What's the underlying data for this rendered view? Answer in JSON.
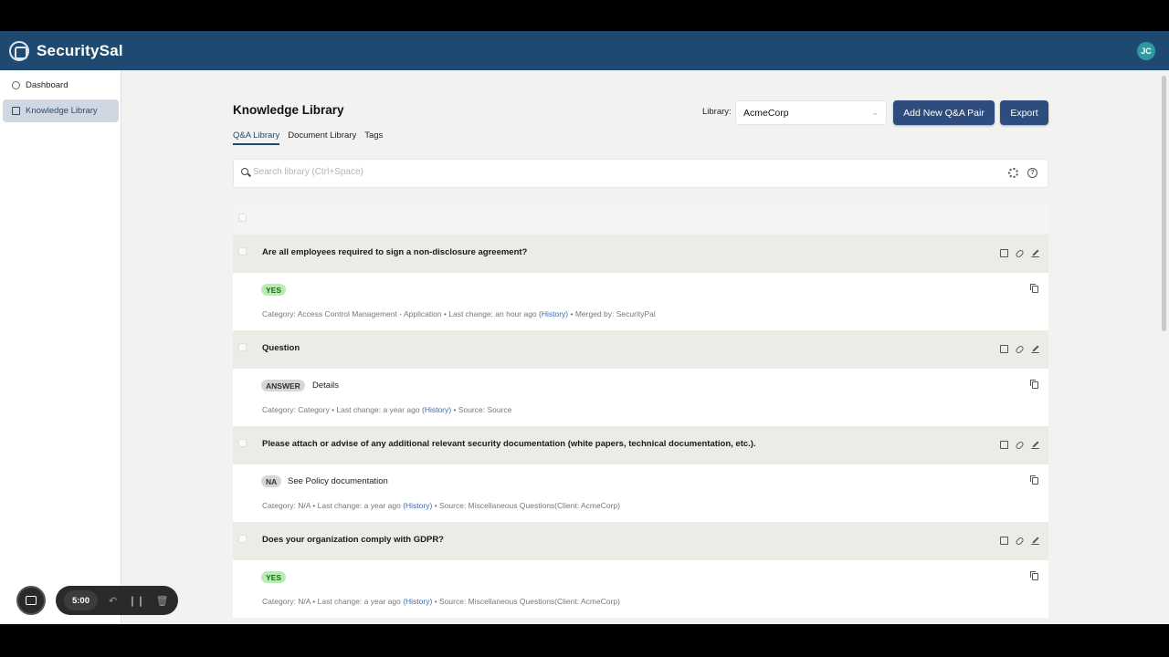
{
  "app": {
    "name": "SecuritySal",
    "avatar_initials": "JC",
    "accent": "#1e4a72"
  },
  "sidebar": {
    "items": [
      {
        "label": "Dashboard",
        "icon": "dashboard-icon",
        "active": false
      },
      {
        "label": "Knowledge Library",
        "icon": "book-icon",
        "active": true
      }
    ]
  },
  "page": {
    "title": "Knowledge Library",
    "tabs": [
      "Q&A Library",
      "Document Library",
      "Tags"
    ],
    "library_label": "Library:",
    "library_value": "AcmeCorp",
    "add_button": "Add New Q&A Pair",
    "export_button": "Export",
    "search_placeholder": "Search library (Ctrl+Space)"
  },
  "entries": [
    {
      "question": "Are all employees required to sign a non-disclosure agreement?",
      "badge": "YES",
      "answer": "",
      "meta_pre": "Category: Access Control Management - Application • Last change: an hour ago",
      "history": "(History)",
      "meta_post": "• Merged by: SecurityPal"
    },
    {
      "question": "Question",
      "badge": "ANSWER",
      "answer": "Details",
      "meta_pre": "Category: Category • Last change: a year ago",
      "history": "(History)",
      "meta_post": "• Source: Source"
    },
    {
      "question": "Please attach or advise of any additional relevant security documentation (white papers, technical documentation, etc.).",
      "badge": "NA",
      "answer": "See Policy documentation",
      "meta_pre": "Category: N/A • Last change: a year ago",
      "history": "(History)",
      "meta_post": "• Source: Miscellaneous Questions(Client: AcmeCorp)"
    },
    {
      "question": "Does your organization comply with GDPR?",
      "badge": "YES",
      "answer": "",
      "meta_pre": "Category: N/A • Last change: a year ago",
      "history": "(History)",
      "meta_post": "• Source: Miscellaneous Questions(Client: AcmeCorp)"
    }
  ],
  "recorder": {
    "time": "5:00"
  }
}
